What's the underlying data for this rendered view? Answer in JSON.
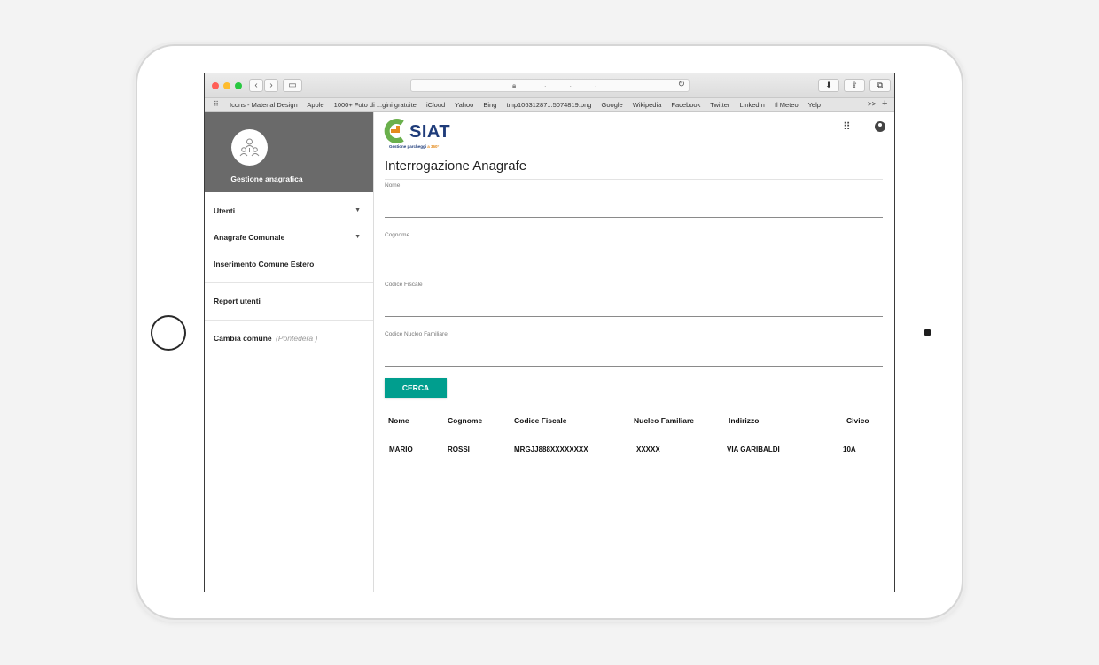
{
  "browser": {
    "bookmarks": [
      "Icons - Material Design",
      "Apple",
      "1000+ Foto di ...gini gratuite",
      "iCloud",
      "Yahoo",
      "Bing",
      "tmp10631287...5074819.png",
      "Google",
      "Wikipedia",
      "Facebook",
      "Twitter",
      "LinkedIn",
      "Il Meteo",
      "Yelp"
    ],
    "more": ">>",
    "new_tab": "+"
  },
  "sidebar": {
    "title": "Gestione anagrafica",
    "items": [
      {
        "label": "Utenti",
        "caret": "▼"
      },
      {
        "label": "Anagrafe Comunale",
        "caret": "▼"
      },
      {
        "label": "Inserimento Comune Estero"
      },
      {
        "label": "Report utenti"
      },
      {
        "label": "Cambia comune",
        "note": "(Pontedera )"
      }
    ]
  },
  "header": {
    "logo_text": "SIAT",
    "logo_tagline": "Gestione parcheggi",
    "logo_tagline_accent": "a 360°",
    "title": "Interrogazione Anagrafe"
  },
  "form": {
    "fields": [
      {
        "label": "Nome",
        "value": ""
      },
      {
        "label": "Cognome",
        "value": ""
      },
      {
        "label": "Codice Fiscale",
        "value": ""
      },
      {
        "label": "Codice Nucleo Familiare",
        "value": ""
      }
    ],
    "submit_label": "CERCA"
  },
  "results": {
    "columns": [
      "Nome",
      "Cognome",
      "Codice Fiscale",
      "Nucleo Familiare",
      "Indirizzo",
      "Civico"
    ],
    "rows": [
      [
        "MARIO",
        "ROSSI",
        "MRGJJ888XXXXXXXX",
        "XXXXX",
        "VIA GARIBALDI",
        "10A"
      ]
    ]
  },
  "icons": {
    "apps": "apps-grid-icon",
    "account": "account-circle-icon",
    "avatar": "users-network-icon"
  },
  "colors": {
    "accent": "#009e8e",
    "sidebar_header": "#6a6a6a",
    "logo_blue": "#1f3c7a",
    "logo_green": "#6ab04c",
    "logo_orange": "#e48b1d"
  }
}
